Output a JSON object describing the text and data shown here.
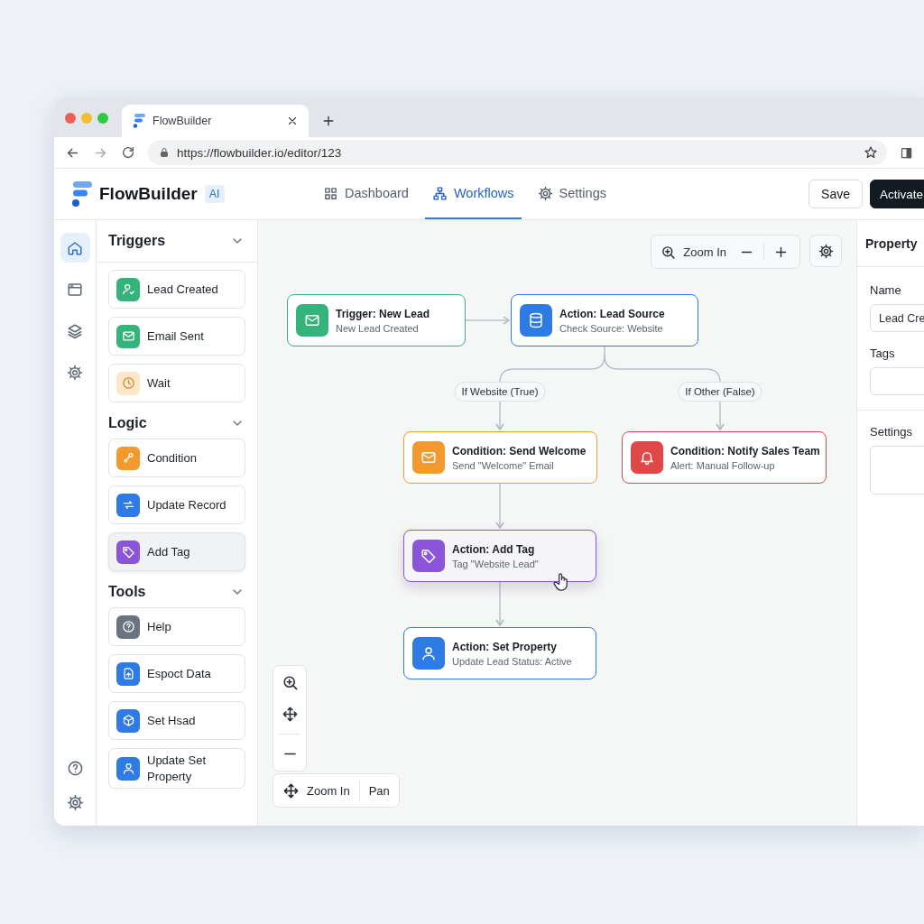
{
  "browser": {
    "tab_title": "FlowBuilder",
    "url": "https://flowbuilder.io/editor/123"
  },
  "header": {
    "app_name": "FlowBuilder",
    "badge": "AI",
    "nav": [
      {
        "label": "Dashboard",
        "selected": false
      },
      {
        "label": "Workflows",
        "selected": true
      },
      {
        "label": "Settings",
        "selected": false
      }
    ],
    "buttons": [
      {
        "label": "Save",
        "kind": "secondary"
      },
      {
        "label": "Activate",
        "kind": "primary"
      }
    ]
  },
  "rail": {
    "items": [
      {
        "selected": true
      },
      {
        "selected": false
      },
      {
        "selected": false
      },
      {
        "selected": false
      }
    ]
  },
  "palette": {
    "sections": [
      {
        "title": "Triggers",
        "items": [
          {
            "label": "Lead Created",
            "color": "#34b37a",
            "soft": false,
            "selected": false
          },
          {
            "label": "Email Sent",
            "color": "#34b37a",
            "soft": false,
            "selected": false
          },
          {
            "label": "Wait",
            "color": "#fde7c8",
            "soft": true,
            "selected": false
          }
        ]
      },
      {
        "title": "Logic",
        "items": [
          {
            "label": "Condition",
            "color": "#f29a2e",
            "soft": false,
            "selected": false
          },
          {
            "label": "Update Record",
            "color": "#2f7be5",
            "soft": false,
            "selected": false
          },
          {
            "label": "Add Tag",
            "color": "#8b55d9",
            "soft": false,
            "selected": true
          }
        ]
      },
      {
        "title": "Tools",
        "items": [
          {
            "label": "Help",
            "color": "#6b7280",
            "soft": false,
            "selected": false
          },
          {
            "label": "Espoct Data",
            "color": "#2f7be5",
            "soft": false,
            "selected": false
          },
          {
            "label": "Set Hsad",
            "color": "#2f7be5",
            "soft": false,
            "selected": false
          },
          {
            "label": "Update Set Property",
            "color": "#2f7be5",
            "soft": false,
            "selected": false
          }
        ]
      }
    ]
  },
  "canvas": {
    "toolbar": {
      "zoom_label": "Zoom In"
    },
    "nodes": [
      {
        "title": "Trigger: New Lead",
        "subtitle": "New Lead Created",
        "color": "#34b37a",
        "selected": false
      },
      {
        "title": "Action: Lead Source",
        "subtitle": "Check Source: Website",
        "color": "#2f7be5",
        "selected": false
      },
      {
        "title": "Condition: Send Welcome",
        "subtitle": "Send \"Welcome\" Email",
        "color": "#f29a2e",
        "selected": false
      },
      {
        "title": "Condition: Notify Sales Team",
        "subtitle": "Alert: Manual Follow-up",
        "color": "#e04848",
        "selected": false
      },
      {
        "title": "Action: Add Tag",
        "subtitle": "Tag \"Website Lead\"",
        "color": "#8b55d9",
        "selected": true
      },
      {
        "title": "Action: Set Property",
        "subtitle": "Update Lead Status: Active",
        "color": "#2f7be5",
        "selected": false
      }
    ],
    "branch_labels": [
      "If Website (True)",
      "If Other (False)"
    ],
    "bottom_bar": {
      "zoom_label": "Zoom In",
      "pan_label": "Pan"
    }
  },
  "properties": {
    "title": "Property",
    "fields": [
      {
        "label": "Name",
        "value": "Lead Cre"
      },
      {
        "label": "Tags"
      }
    ],
    "settings_label": "Settings"
  }
}
